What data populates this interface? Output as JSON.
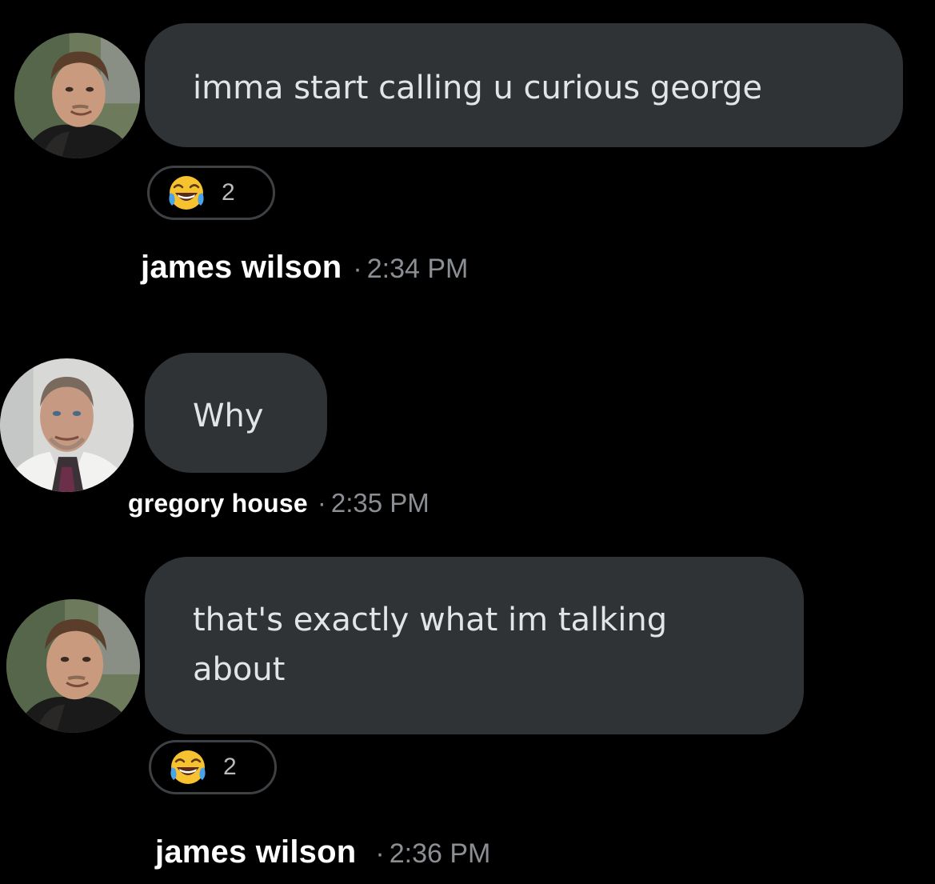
{
  "colors": {
    "background": "#000000",
    "bubble": "#2f3336",
    "bubble_text": "#e2e4e6",
    "name_text": "#ffffff",
    "time_text": "#8b8f93",
    "reaction_border": "#3e4144"
  },
  "messages": [
    {
      "sender": "james wilson",
      "avatar_icon": "james-wilson-avatar",
      "text_lines": [
        "imma start calling u curious george"
      ],
      "reaction": {
        "emoji_icon": "face-with-tears-of-joy-icon",
        "count": "2"
      },
      "separator": "·",
      "time": "2:34 PM"
    },
    {
      "sender": "gregory house",
      "avatar_icon": "gregory-house-avatar",
      "text_lines": [
        "Why"
      ],
      "reaction": null,
      "separator": "·",
      "time": "2:35 PM"
    },
    {
      "sender": "james wilson",
      "avatar_icon": "james-wilson-avatar",
      "text_lines": [
        "that's exactly what im talking",
        "about"
      ],
      "reaction": {
        "emoji_icon": "face-with-tears-of-joy-icon",
        "count": "2"
      },
      "separator": "·",
      "time": "2:36 PM"
    }
  ]
}
